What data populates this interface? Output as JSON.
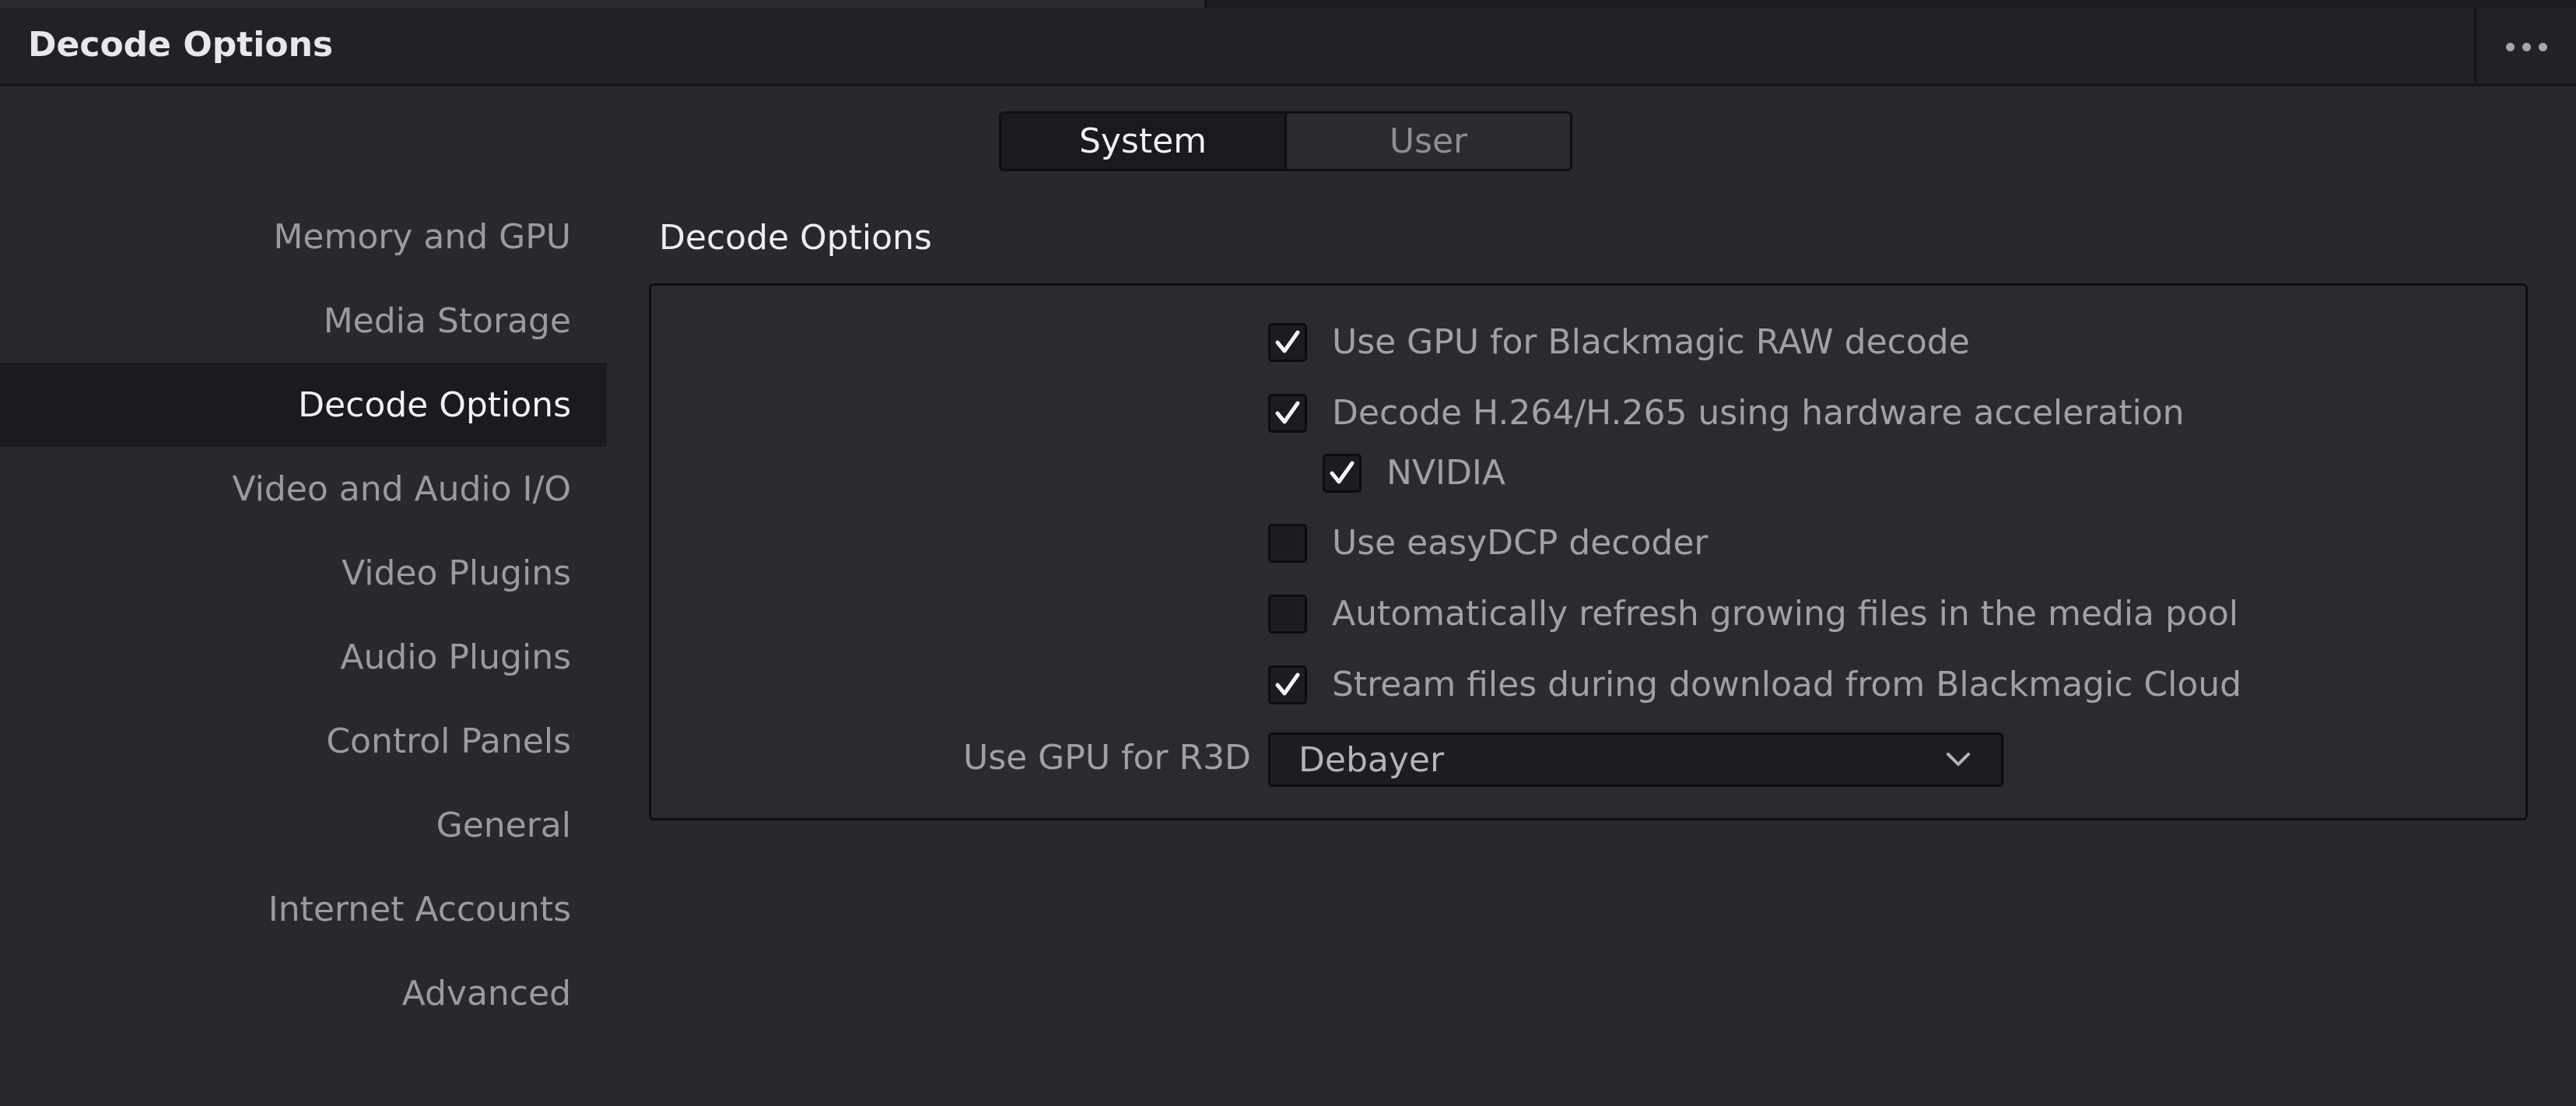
{
  "window": {
    "title": "Decode Options"
  },
  "tabs": [
    {
      "label": "System",
      "active": true
    },
    {
      "label": "User",
      "active": false
    }
  ],
  "sidebar": {
    "items": [
      {
        "label": "Memory and GPU",
        "active": false
      },
      {
        "label": "Media Storage",
        "active": false
      },
      {
        "label": "Decode Options",
        "active": true
      },
      {
        "label": "Video and Audio I/O",
        "active": false
      },
      {
        "label": "Video Plugins",
        "active": false
      },
      {
        "label": "Audio Plugins",
        "active": false
      },
      {
        "label": "Control Panels",
        "active": false
      },
      {
        "label": "General",
        "active": false
      },
      {
        "label": "Internet Accounts",
        "active": false
      },
      {
        "label": "Advanced",
        "active": false
      }
    ]
  },
  "section": {
    "title": "Decode Options",
    "options": [
      {
        "label": "Use GPU for Blackmagic RAW decode",
        "checked": true
      },
      {
        "label": "Decode H.264/H.265 using hardware acceleration",
        "checked": true
      },
      {
        "label": "NVIDIA",
        "checked": true
      },
      {
        "label": "Use easyDCP decoder",
        "checked": false
      },
      {
        "label": "Automatically refresh growing files in the media pool",
        "checked": false
      },
      {
        "label": "Stream files during download from Blackmagic Cloud",
        "checked": true
      }
    ],
    "r3d": {
      "label": "Use GPU for R3D",
      "value": "Debayer"
    }
  },
  "icons": {
    "more": "more-horizontal-icon",
    "check": "checkmark-icon",
    "dropdown": "chevron-down-icon"
  },
  "colors": {
    "background": "#28282e",
    "header": "#212126",
    "active_item": "#1b1b1f",
    "text": "#9a9a9f",
    "text_active": "#f2f2f4"
  }
}
